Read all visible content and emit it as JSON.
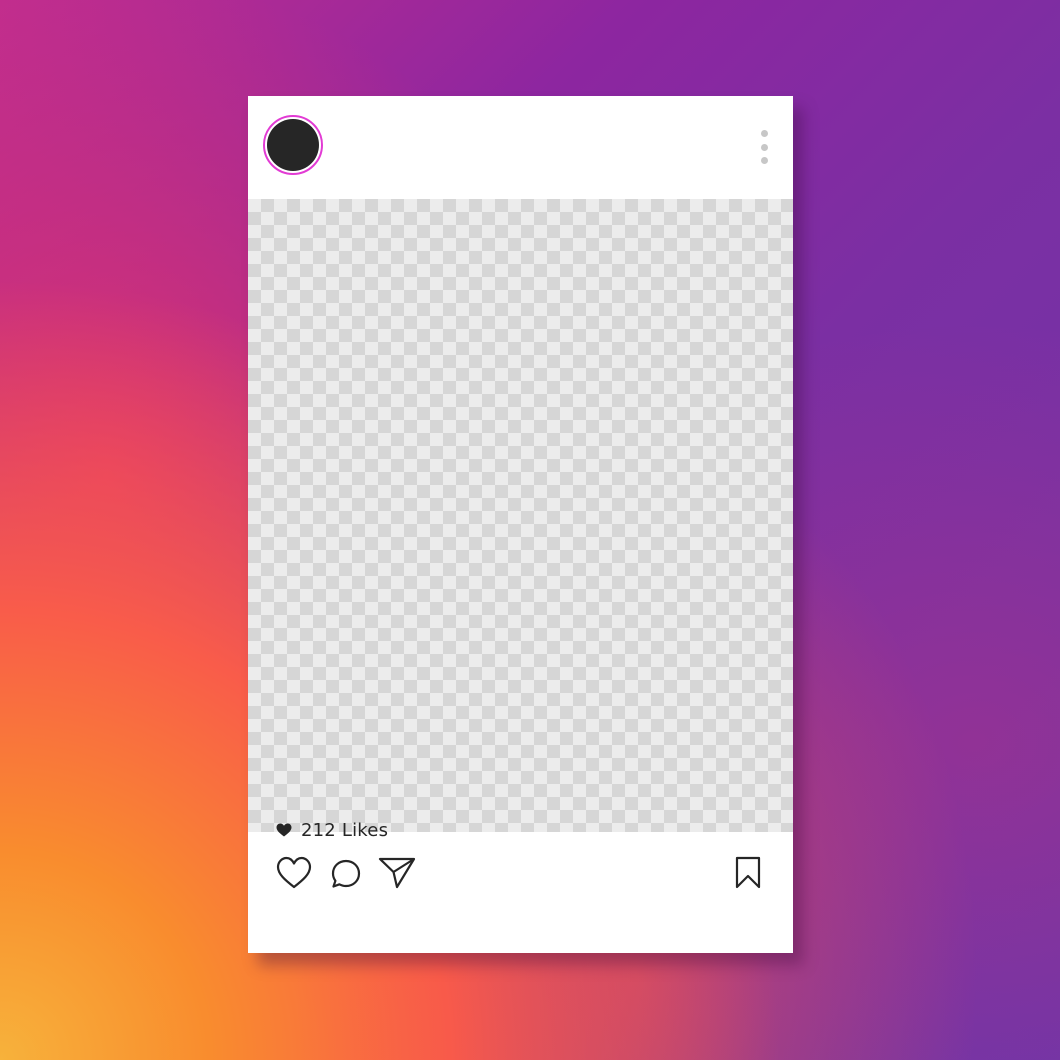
{
  "colors": {
    "avatar_ring": "#e23bd4",
    "avatar_fill": "#262626",
    "card_background": "#ffffff",
    "more_dots": "#c7c7c7",
    "checker_light": "#ececec",
    "checker_dark": "#d6d6d6"
  },
  "post": {
    "header": {
      "avatar_icon": "profile-avatar",
      "menu_icon": "vertical-ellipsis-icon"
    },
    "image": {
      "placeholder_pattern": "transparency-checkerboard"
    },
    "actions": {
      "like_icon": "heart-outline-icon",
      "comment_icon": "speech-bubble-icon",
      "share_icon": "paper-plane-icon",
      "save_icon": "bookmark-icon"
    },
    "likes": {
      "icon": "heart-filled-icon",
      "label": "212 Likes"
    }
  }
}
